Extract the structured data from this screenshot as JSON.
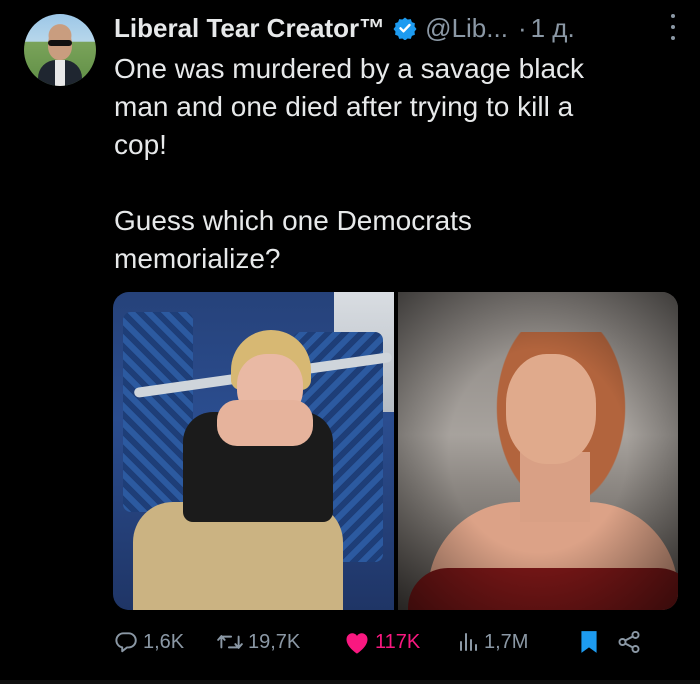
{
  "tweet": {
    "author_name": "Liberal Tear Creator™",
    "handle": "@Lib...",
    "separator": "·",
    "time": "1 д.",
    "text": "One was murdered by a savage black\nman and one died after trying to kill a\ncop!\n\nGuess which one Democrats\nmemorialize?"
  },
  "actions": {
    "replies": "1,6K",
    "retweets": "19,7K",
    "likes": "117K",
    "views": "1,7M"
  },
  "icons": {
    "verified": "verified-badge-icon",
    "more": "more-options-icon",
    "reply": "reply-icon",
    "retweet": "retweet-icon",
    "like": "heart-icon",
    "views": "views-icon",
    "bookmark": "bookmark-icon",
    "share": "share-icon"
  },
  "colors": {
    "background": "#000000",
    "text": "#e7e9ea",
    "secondary": "#8b98a5",
    "like": "#f91880",
    "accent": "#1d9bf0"
  }
}
